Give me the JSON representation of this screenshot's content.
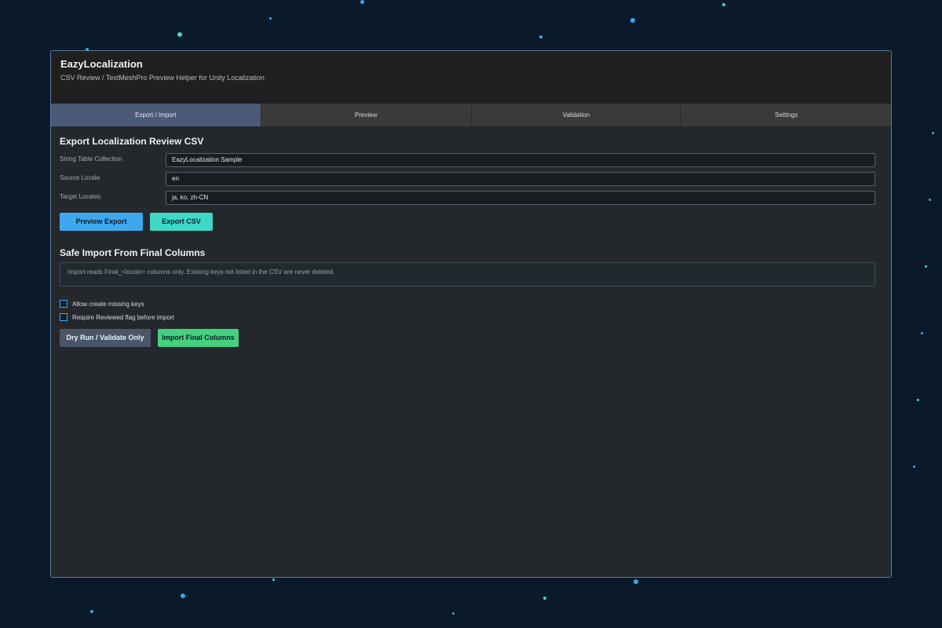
{
  "app": {
    "title": "EazyLocalization",
    "subtitle": "CSV Review / TextMeshPro Preview Helper for Unity Localization"
  },
  "tabs": [
    {
      "label": "Export / Import",
      "active": true
    },
    {
      "label": "Preview",
      "active": false
    },
    {
      "label": "Validation",
      "active": false
    },
    {
      "label": "Settings",
      "active": false
    }
  ],
  "export": {
    "title": "Export Localization Review CSV",
    "fields": [
      {
        "label": "String Table Collection",
        "value": "EazyLocalization Sample"
      },
      {
        "label": "Source Locale",
        "value": "en"
      },
      {
        "label": "Target Locales",
        "value": "ja, ko, zh-CN"
      }
    ],
    "preview_button": "Preview Export",
    "export_button": "Export CSV"
  },
  "import": {
    "title": "Safe Import From Final Columns",
    "info": "Import reads Final_<locale> columns only. Existing keys not listed in the CSV are never deleted.",
    "options": [
      {
        "label": "Allow create missing keys",
        "checked": false
      },
      {
        "label": "Require Reviewed flag before import",
        "checked": false
      }
    ],
    "dry_run_button": "Dry Run / Validate Only",
    "import_button": "Import Final Columns"
  },
  "colors": {
    "background": "#0a1a2a",
    "panel": "#24282d",
    "active_tab": "#4a5a78",
    "accent_blue": "#3ea8ee",
    "accent_teal": "#3ed8c6",
    "accent_green": "#45d080"
  }
}
